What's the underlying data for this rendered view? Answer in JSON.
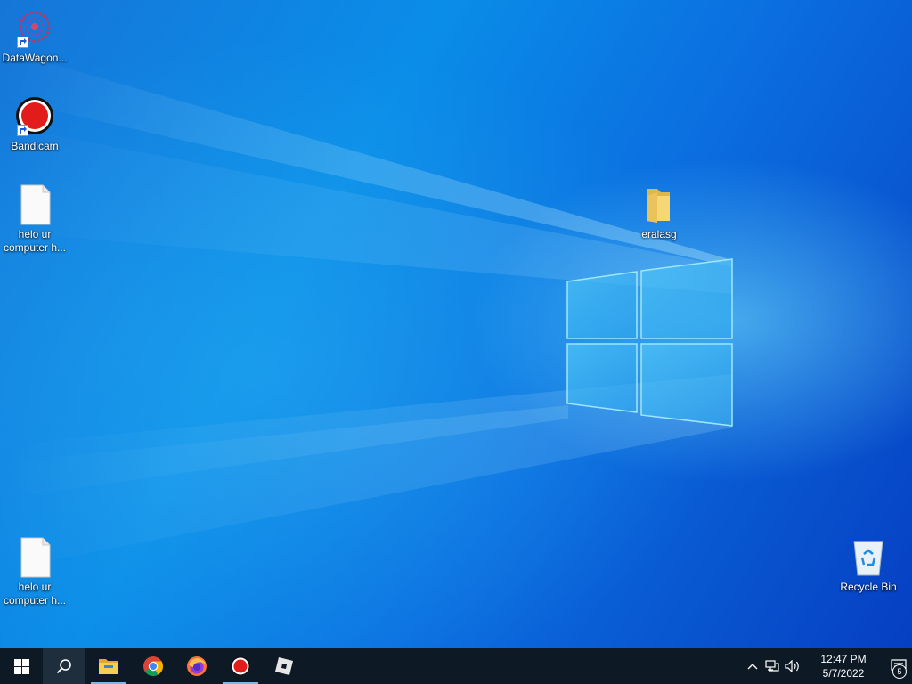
{
  "desktop": {
    "icons": [
      {
        "label": "DataWagon...",
        "icon": "datawagon-icon"
      },
      {
        "label": "Bandicam",
        "icon": "bandicam-icon"
      },
      {
        "label": "helo ur computer h...",
        "icon": "text-file-icon"
      },
      {
        "label": "eralasg",
        "icon": "folder-icon"
      },
      {
        "label": "helo ur computer h...",
        "icon": "text-file-icon"
      },
      {
        "label": "Recycle Bin",
        "icon": "recycle-bin-icon"
      }
    ]
  },
  "taskbar": {
    "buttons": [
      {
        "name": "start-button",
        "icon": "windows-logo-icon"
      },
      {
        "name": "search-button",
        "icon": "search-icon"
      },
      {
        "name": "file-explorer-button",
        "icon": "file-explorer-icon"
      },
      {
        "name": "chrome-button",
        "icon": "chrome-icon"
      },
      {
        "name": "firefox-button",
        "icon": "firefox-icon"
      },
      {
        "name": "bandicam-button",
        "icon": "bandicam-icon"
      },
      {
        "name": "roblox-button",
        "icon": "roblox-icon"
      }
    ],
    "clock": {
      "time": "12:47 PM",
      "date": "5/7/2022"
    },
    "notifications": {
      "count": "5"
    }
  },
  "colors": {
    "taskbar": "#0d1a26",
    "accent": "#76b9ed",
    "wallpaper": "#0a5fd0"
  }
}
